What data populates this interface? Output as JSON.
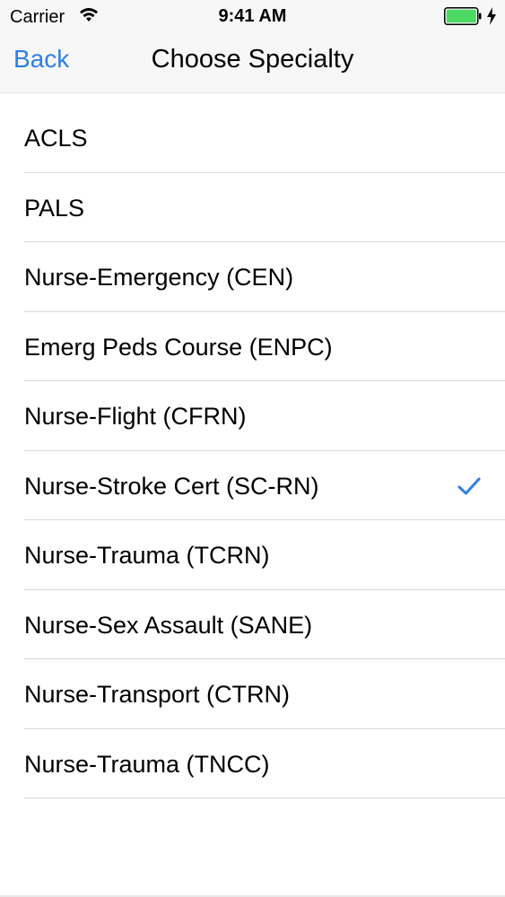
{
  "status_bar": {
    "carrier": "Carrier",
    "time": "9:41 AM",
    "battery_color": "#4cd964"
  },
  "nav": {
    "back_label": "Back",
    "title": "Choose Specialty",
    "accent_color": "#2f7fe0"
  },
  "specialties": [
    {
      "label": "ACLS",
      "selected": false
    },
    {
      "label": "PALS",
      "selected": false
    },
    {
      "label": "Nurse-Emergency (CEN)",
      "selected": false
    },
    {
      "label": "Emerg Peds Course (ENPC)",
      "selected": false
    },
    {
      "label": "Nurse-Flight (CFRN)",
      "selected": false
    },
    {
      "label": "Nurse-Stroke Cert (SC-RN)",
      "selected": true
    },
    {
      "label": "Nurse-Trauma (TCRN)",
      "selected": false
    },
    {
      "label": "Nurse-Sex Assault (SANE)",
      "selected": false
    },
    {
      "label": "Nurse-Transport (CTRN)",
      "selected": false
    },
    {
      "label": "Nurse-Trauma (TNCC)",
      "selected": false
    }
  ],
  "icons": {
    "wifi": "wifi-icon",
    "battery": "battery-icon",
    "charging": "charging-bolt-icon",
    "selected": "checkmark-icon"
  }
}
